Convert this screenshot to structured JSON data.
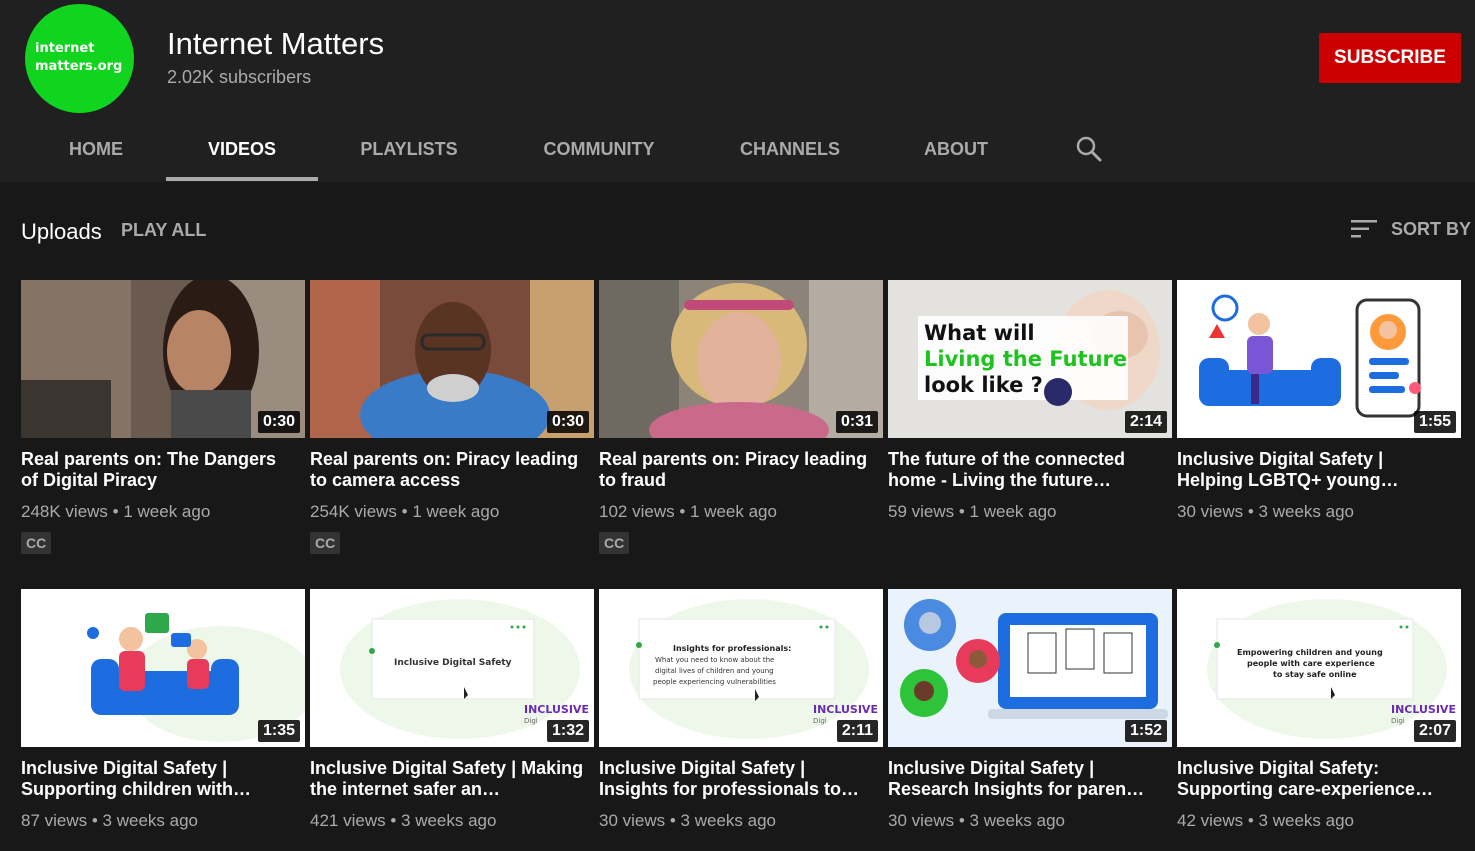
{
  "channel": {
    "logo_line1": "internet",
    "logo_line2": "matters.org",
    "name": "Internet Matters",
    "subscribers": "2.02K subscribers",
    "subscribe_label": "SUBSCRIBE"
  },
  "tabs": [
    {
      "label": "HOME",
      "active": false
    },
    {
      "label": "VIDEOS",
      "active": true
    },
    {
      "label": "PLAYLISTS",
      "active": false
    },
    {
      "label": "COMMUNITY",
      "active": false
    },
    {
      "label": "CHANNELS",
      "active": false
    },
    {
      "label": "ABOUT",
      "active": false
    }
  ],
  "uploads": {
    "title": "Uploads",
    "play_all": "PLAY ALL",
    "sort_by": "SORT BY"
  },
  "videos": [
    {
      "title": "Real parents on: The Dangers of Digital Piracy",
      "views": "248K views",
      "age": "1 week ago",
      "duration": "0:30",
      "badge": "CC"
    },
    {
      "title": "Real parents on: Piracy leading to camera access",
      "views": "254K views",
      "age": "1 week ago",
      "duration": "0:30",
      "badge": "CC"
    },
    {
      "title": "Real parents on: Piracy leading to fraud",
      "views": "102 views",
      "age": "1 week ago",
      "duration": "0:31",
      "badge": "CC"
    },
    {
      "title": "The future of the connected home - Living the future…",
      "views": "59 views",
      "age": "1 week ago",
      "duration": "2:14",
      "badge": ""
    },
    {
      "title": "Inclusive Digital Safety | Helping LGBTQ+ young…",
      "views": "30 views",
      "age": "3 weeks ago",
      "duration": "1:55",
      "badge": ""
    },
    {
      "title": "Inclusive Digital Safety | Supporting children with…",
      "views": "87 views",
      "age": "3 weeks ago",
      "duration": "1:35",
      "badge": ""
    },
    {
      "title": "Inclusive Digital Safety | Making the internet safer an…",
      "views": "421 views",
      "age": "3 weeks ago",
      "duration": "1:32",
      "badge": ""
    },
    {
      "title": "Inclusive Digital Safety | Insights for professionals to…",
      "views": "30 views",
      "age": "3 weeks ago",
      "duration": "2:11",
      "badge": ""
    },
    {
      "title": "Inclusive Digital Safety | Research Insights for paren…",
      "views": "30 views",
      "age": "3 weeks ago",
      "duration": "1:52",
      "badge": ""
    },
    {
      "title": "Inclusive Digital Safety: Supporting care-experience…",
      "views": "42 views",
      "age": "3 weeks ago",
      "duration": "2:07",
      "badge": ""
    }
  ],
  "thumbnail_text": {
    "future_line1": "What will",
    "future_line2": "Living the Future",
    "future_line3": "look like ?",
    "slide_v7": "Inclusive Digital Safety",
    "slide_v8_heading": "Insights for professionals:",
    "slide_v8_line1": "What you need to know about the",
    "slide_v8_line2": "digital lives of children and young",
    "slide_v8_line3": "people experiencing vulnerabilities",
    "slide_v10_line1": "Empowering children and young",
    "slide_v10_line2": "people with care experience",
    "slide_v10_line3": "to stay safe online",
    "inclusive_logo": "INCLUSIVE",
    "inclusive_sub": "Digi"
  },
  "icons": {
    "search": "search-icon",
    "sort": "sort-icon"
  },
  "colors": {
    "subscribe": "#cc0000",
    "brand_green": "#10d41d",
    "background": "#181818",
    "header": "#202020"
  }
}
